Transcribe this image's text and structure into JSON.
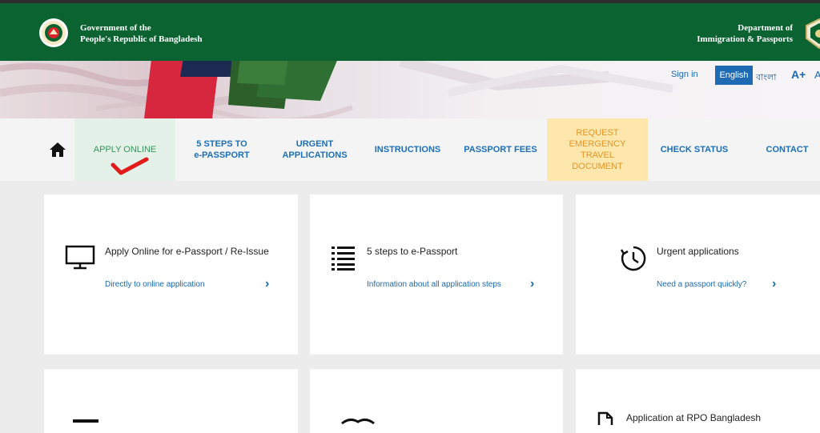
{
  "header": {
    "gov_line1": "Government of the",
    "gov_line2": "People's Republic of Bangladesh",
    "dept_line1": "Department of",
    "dept_line2": "Immigration & Passports"
  },
  "utility": {
    "sign_in": "Sign in",
    "lang_english": "English",
    "lang_bangla": "বাংলা",
    "font_increase": "A+",
    "font_default": "A"
  },
  "nav": {
    "apply_online": "APPLY ONLINE",
    "steps_line1": "5 STEPS TO",
    "steps_line2": "e-PASSPORT",
    "urgent_line1": "URGENT",
    "urgent_line2": "APPLICATIONS",
    "instructions": "INSTRUCTIONS",
    "fees": "PASSPORT FEES",
    "req_line1": "REQUEST",
    "req_line2": "EMERGENCY",
    "req_line3": "TRAVEL",
    "req_line4": "DOCUMENT",
    "check_status": "CHECK STATUS",
    "contact": "CONTACT"
  },
  "cards": [
    {
      "title": "Apply Online for e-Passport / Re-Issue",
      "link": "Directly to online application",
      "icon": "monitor-icon"
    },
    {
      "title": "5 steps to e-Passport",
      "link": "Information about all application steps",
      "icon": "list-icon"
    },
    {
      "title": "Urgent applications",
      "link": "Need a passport quickly?",
      "icon": "clock-icon"
    },
    {
      "title": "Application at RPO Bangladesh",
      "icon": "document-icon"
    }
  ],
  "colors": {
    "header_green": "#0a6330",
    "link_blue": "#1a6ab0",
    "apply_highlight": "#e3f1e8",
    "request_highlight": "#fde7ad"
  }
}
